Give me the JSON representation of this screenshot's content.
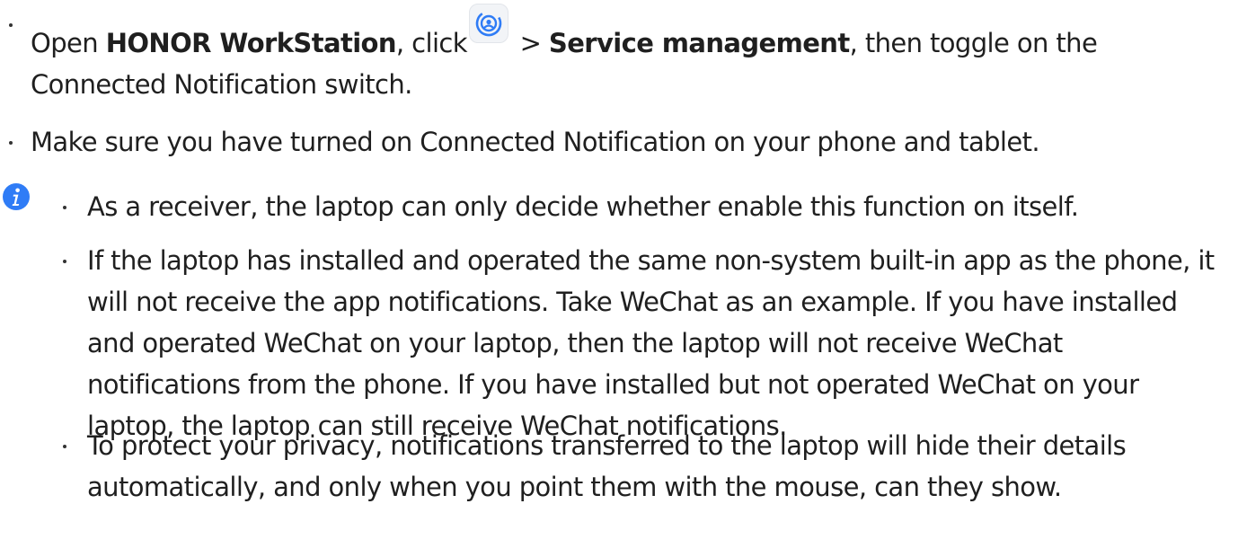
{
  "bullets": {
    "item1": {
      "prefix": "Open ",
      "app_name": "HONOR WorkStation",
      "after_app": ", click",
      "icon": "workstation-settings-icon",
      "gt": " > ",
      "menu_item": "Service management",
      "suffix": ", then toggle on the Connected Notification switch."
    },
    "item2": {
      "text": "Make sure you have turned on Connected Notification on your phone and tablet."
    }
  },
  "note": {
    "icon": "info-icon",
    "items": [
      "As a receiver, the laptop can only decide whether enable this function on itself.",
      "If the laptop has installed and operated the same non-system built-in app as the phone, it will not receive the app notifications. Take WeChat as an example. If you have installed and operated WeChat on your laptop, then the laptop will not receive WeChat notifications from the phone. If you have installed but not operated WeChat on your laptop, the laptop can still receive WeChat notifications.",
      "To protect your privacy, notifications transferred to the laptop will hide their details automatically, and only when you point them with the mouse, can they show."
    ]
  },
  "colors": {
    "text": "#1f1f1f",
    "accent_blue": "#2f7cf6",
    "icon_bg": "#f2f4f7"
  }
}
